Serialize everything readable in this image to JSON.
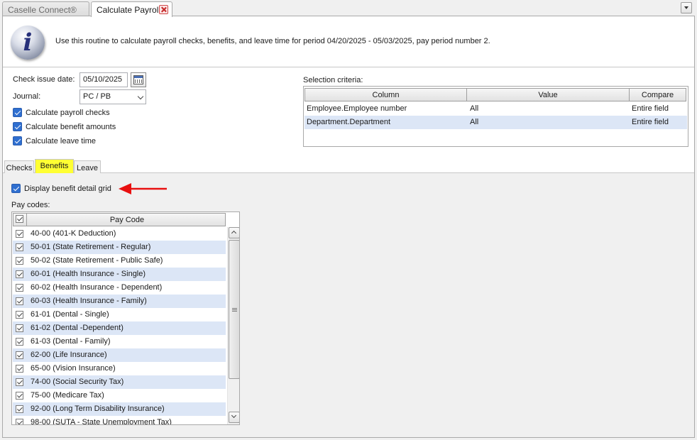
{
  "tabs": {
    "inactive_label": "Caselle Connect®",
    "active_label": "Calculate Payroll"
  },
  "info": {
    "message": "Use this routine to calculate payroll checks, benefits, and leave time for period 04/20/2025 - 05/03/2025, pay period number 2."
  },
  "form": {
    "check_issue_date_label": "Check issue date:",
    "check_issue_date_value": "05/10/2025",
    "journal_label": "Journal:",
    "journal_value": "PC / PB",
    "calc_payroll_checks": "Calculate payroll checks",
    "calc_benefit_amounts": "Calculate benefit amounts",
    "calc_leave_time": "Calculate leave time"
  },
  "selection": {
    "label": "Selection criteria:",
    "headers": [
      "Column",
      "Value",
      "Compare"
    ],
    "rows": [
      [
        "Employee.Employee number",
        "All",
        "Entire field"
      ],
      [
        "Department.Department",
        "All",
        "Entire field"
      ]
    ]
  },
  "inner_tabs": [
    "Checks",
    "Benefits",
    "Leave"
  ],
  "benefits": {
    "display_detail_grid": "Display benefit detail grid",
    "pay_codes_label": "Pay codes:",
    "pay_code_header": "Pay Code",
    "pay_codes": [
      "40-00 (401-K Deduction)",
      "50-01 (State Retirement - Regular)",
      "50-02 (State Retirement - Public Safe)",
      "60-01 (Health Insurance - Single)",
      "60-02 (Health Insurance - Dependent)",
      "60-03 (Health Insurance - Family)",
      "61-01 (Dental - Single)",
      "61-02 (Dental -Dependent)",
      "61-03 (Dental - Family)",
      "62-00 (Life Insurance)",
      "65-00 (Vision Insurance)",
      "74-00 (Social Security Tax)",
      "75-00 (Medicare Tax)",
      "92-00 (Long Term Disability Insurance)",
      "98-00 (SUTA - State Unemployment Tax)"
    ]
  },
  "colors": {
    "active_tab_highlight": "#ffff33",
    "annotation_arrow": "#e81010",
    "checkbox_blue": "#2f6fd0",
    "alt_row": "#dce6f6"
  }
}
